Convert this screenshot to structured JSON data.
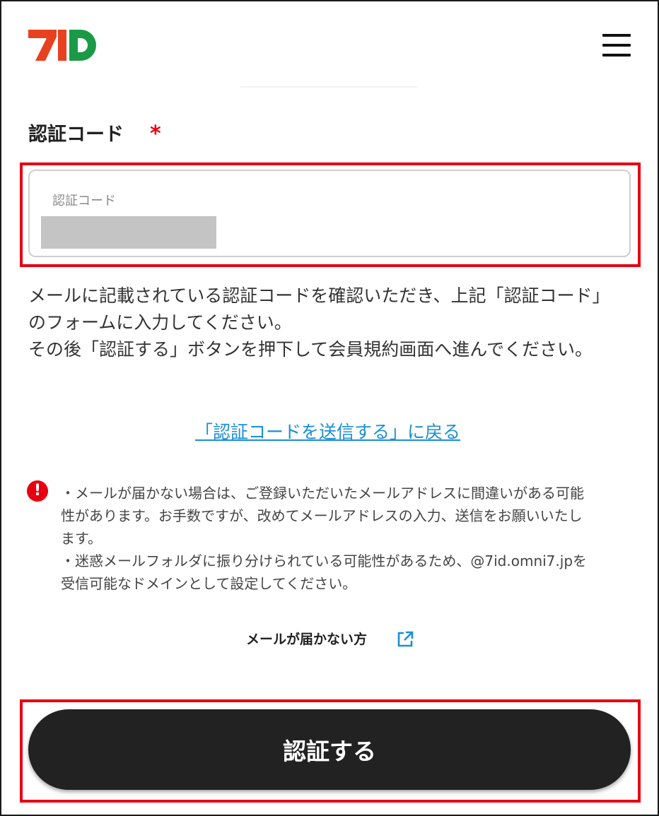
{
  "header": {
    "logo_text": "7iD",
    "menu_icon": "hamburger-menu-icon"
  },
  "form": {
    "field_label": "認証コード",
    "required_mark": "*",
    "input_placeholder": "認証コード"
  },
  "description": {
    "line1": "メールに記載されている認証コードを確認いただき、上記「認証コード」",
    "line2": "のフォームに入力してください。",
    "line3": "その後「認証する」ボタンを押下して会員規約画面へ進んでください。"
  },
  "back_link": "「認証コードを送信する」に戻る",
  "notes": {
    "icon": "exclamation-circle-icon",
    "line1": "・メールが届かない場合は、ご登録いただいたメールアドレスに間違いがある可能",
    "line2": "性があります。お手数ですが、改めてメールアドレスの入力、送信をお願いいたし",
    "line3": "ます。",
    "line4": "・迷惑メールフォルダに振り分けられている可能性があるため、@7id.omni7.jpを",
    "line5": "受信可能なドメインとして設定してください。"
  },
  "help_link": {
    "label": "メールが届かない方",
    "icon": "external-link-icon"
  },
  "submit_button": "認証する",
  "colors": {
    "brand_red": "#e8411f",
    "brand_green": "#1a9a46",
    "required_red": "#e60012",
    "link_blue": "#1a8fd6",
    "button_dark": "#222222"
  }
}
